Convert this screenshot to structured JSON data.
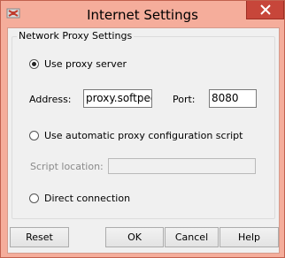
{
  "window": {
    "title": "Internet Settings",
    "icons": {
      "app": "app-logo-icon",
      "close": "close-icon"
    }
  },
  "group": {
    "label": "Network Proxy Settings"
  },
  "proxy": {
    "use_proxy_label": "Use proxy server",
    "use_proxy_checked": true,
    "address_label": "Address:",
    "address_value": "proxy.softpedia",
    "port_label": "Port:",
    "port_value": "8080",
    "auto_config_label": "Use automatic proxy configuration script",
    "auto_config_checked": false,
    "script_location_label": "Script location:",
    "script_location_value": "",
    "direct_label": "Direct connection",
    "direct_checked": false
  },
  "buttons": {
    "reset": "Reset",
    "ok": "OK",
    "cancel": "Cancel",
    "help": "Help"
  }
}
